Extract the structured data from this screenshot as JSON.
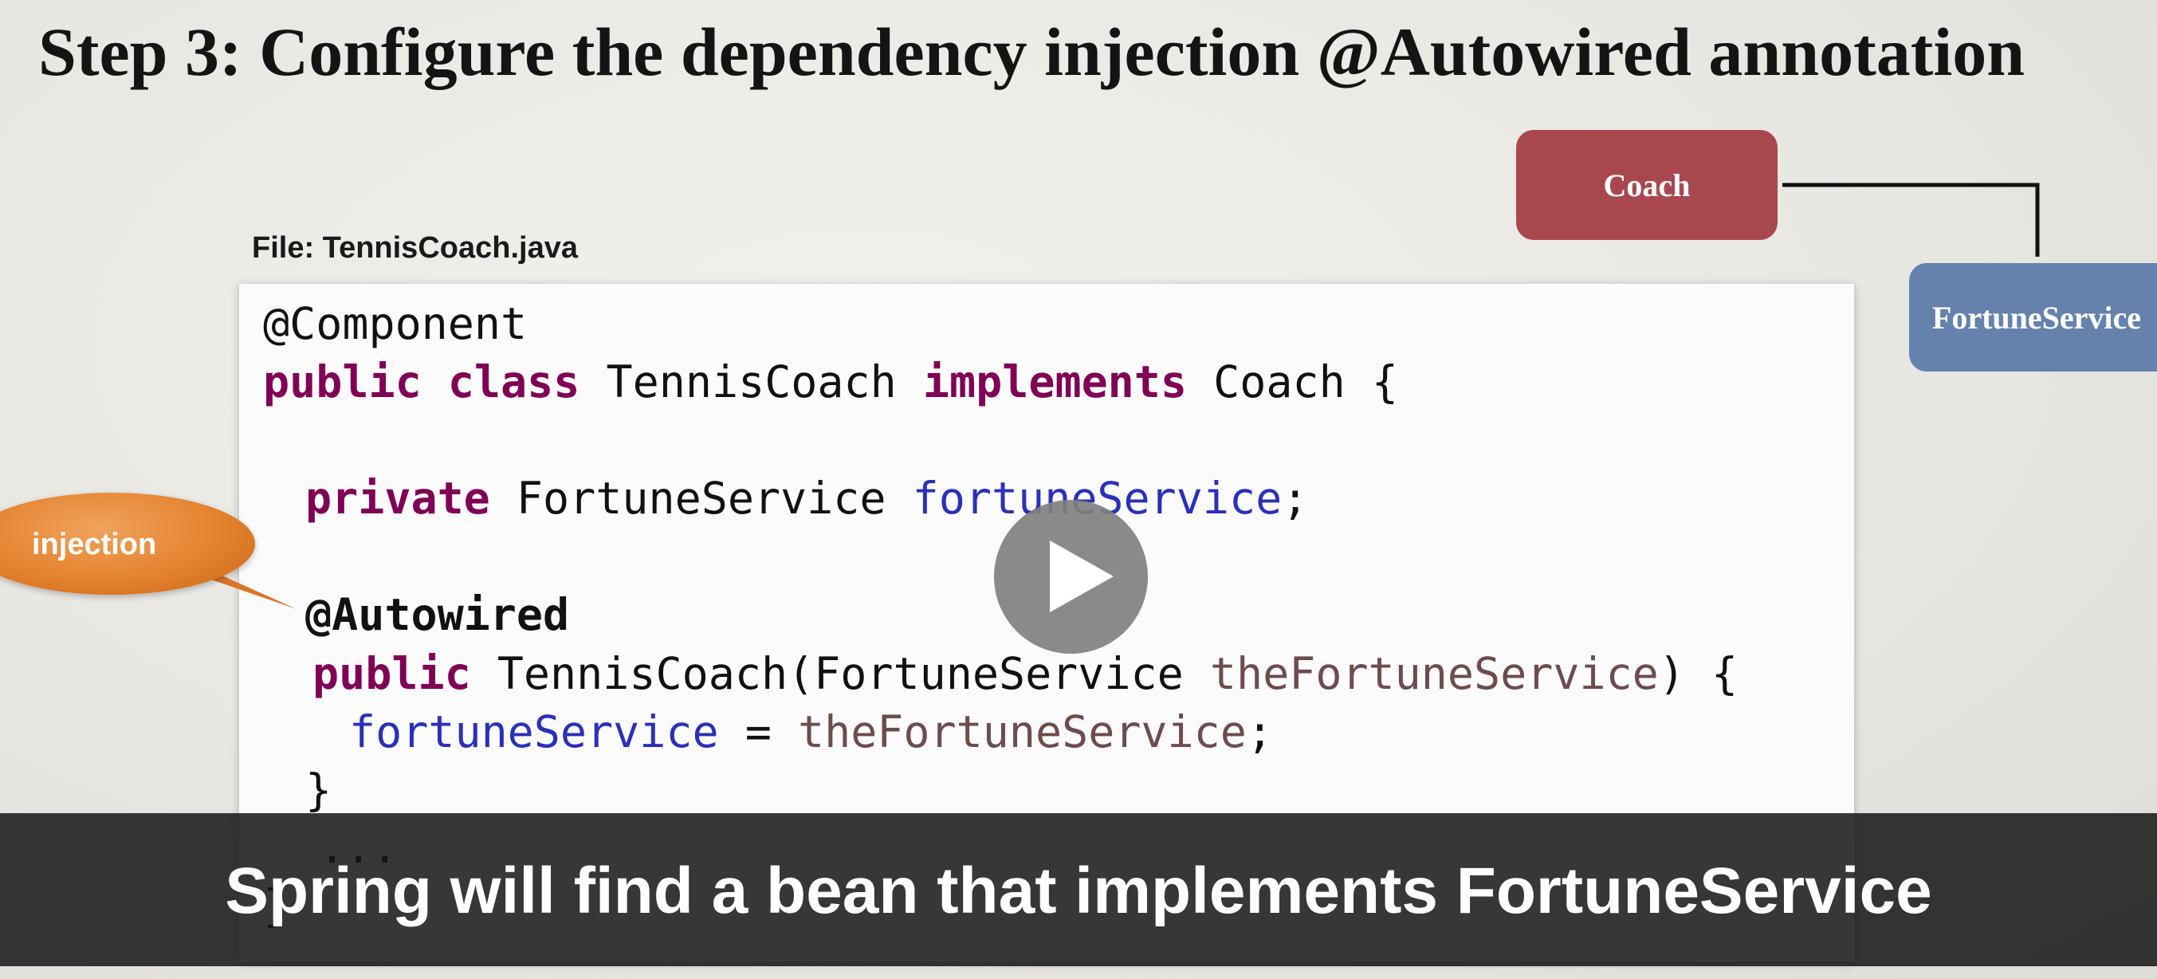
{
  "slide": {
    "title": "Step 3: Configure the dependency injection @Autowired annotation"
  },
  "file": {
    "label": "File: TennisCoach.java"
  },
  "code": {
    "line1": {
      "annotation": "@Component"
    },
    "line2": {
      "kw_public": "public",
      "kw_class": "class",
      "class_name": "TennisCoach",
      "kw_implements": "implements",
      "interface": "Coach",
      "brace": "{"
    },
    "line3": {
      "kw_private": "private",
      "type": "FortuneService",
      "field": "fortuneService",
      "semi": ";"
    },
    "line4": {
      "annotation": "@Autowired"
    },
    "line5": {
      "kw_public": "public",
      "signature_start": "TennisCoach(FortuneService",
      "param": "theFortuneService",
      "signature_end": ") {"
    },
    "line6": {
      "field": "fortuneService",
      "assign": "=",
      "param": "theFortuneService",
      "semi": ";"
    },
    "line7": {
      "text": "}"
    },
    "line8": {
      "text": "..."
    },
    "line9": {
      "text": "}"
    }
  },
  "diagram": {
    "coach_label": "Coach",
    "fortune_label": "FortuneService",
    "coach_color": "#a9474f",
    "fortune_color": "#6582ad"
  },
  "callout": {
    "label": "injection",
    "color": "#e4822e"
  },
  "player": {
    "play_icon": "play-icon"
  },
  "subtitle": {
    "text": "Spring will find a bean that implements FortuneService"
  }
}
